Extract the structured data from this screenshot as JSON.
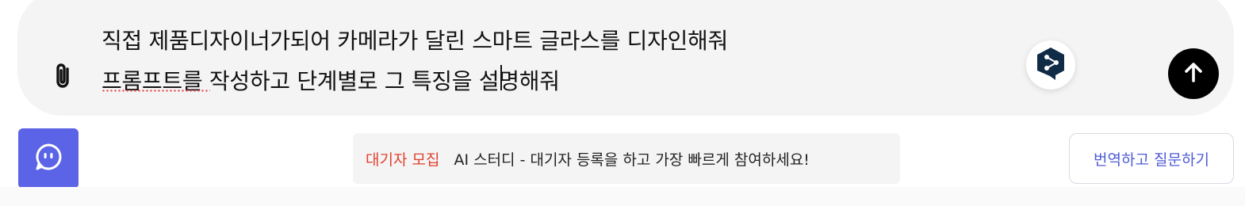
{
  "composer": {
    "prompt_lines": "직접 제품디자이너가되어 카메라가 달린 스마트 글라스를 디자인해줘\n프롬프트를 작성하고 단계별로 그 특징을 설명해줘",
    "attach_icon": "paperclip-icon",
    "deepl_icon": "deepl-icon",
    "send_icon": "arrow-up-icon"
  },
  "footer": {
    "assistant_icon": "assistant-face-icon",
    "banner_tag": "대기자 모집",
    "banner_text": "AI 스터디 - 대기자 등록을 하고 가장 빠르게 참여하세요!",
    "translate_button": "번역하고 질문하기"
  },
  "colors": {
    "composer_bg": "#f4f4f4",
    "accent": "#5b63e6",
    "banner_tag": "#e0412f",
    "send_bg": "#000000",
    "deepl_bg": "#0f2b46"
  }
}
